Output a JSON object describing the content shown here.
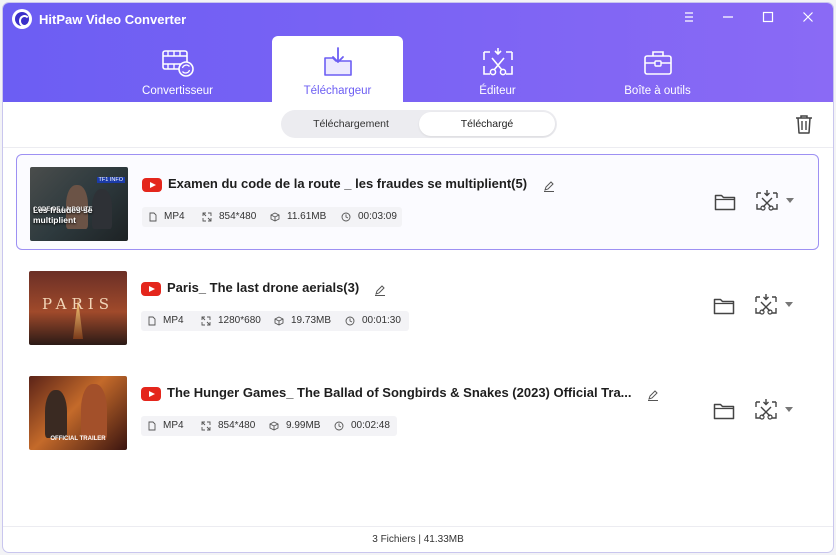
{
  "app": {
    "title": "HitPaw Video Converter"
  },
  "nav": {
    "tabs": [
      {
        "label": "Convertisseur",
        "icon": "film-convert-icon"
      },
      {
        "label": "Téléchargeur",
        "icon": "download-folder-icon"
      },
      {
        "label": "Éditeur",
        "icon": "scissors-icon"
      },
      {
        "label": "Boîte à outils",
        "icon": "toolbox-icon"
      }
    ],
    "active": "Téléchargeur"
  },
  "segment": {
    "downloading": "Téléchargement",
    "downloaded": "Téléchargé",
    "selected": "Téléchargé"
  },
  "videos": [
    {
      "title": "Examen du code de la route _ les fraudes se multiplient(5)",
      "format": "MP4",
      "resolution": "854*480",
      "size": "11.61MB",
      "duration": "00:03:09",
      "thumb_text": "Les fraudes se multiplient",
      "thumb_top": "CODE DE LA ROUTE",
      "thumb_badge": "TF1 INFO"
    },
    {
      "title": "Paris_ The last drone aerials(3)",
      "format": "MP4",
      "resolution": "1280*680",
      "size": "19.73MB",
      "duration": "00:01:30",
      "thumb_text": "PARIS"
    },
    {
      "title": "The Hunger Games_ The Ballad of Songbirds & Snakes (2023) Official Tra...",
      "format": "MP4",
      "resolution": "854*480",
      "size": "9.99MB",
      "duration": "00:02:48",
      "thumb_text": "OFFICIAL TRAILER"
    }
  ],
  "status": {
    "summary": "3 Fichiers | 41.33MB"
  },
  "colors": {
    "accent": "#6c5ef3",
    "youtube": "#e4261c",
    "selected_border": "#9d90f3"
  }
}
